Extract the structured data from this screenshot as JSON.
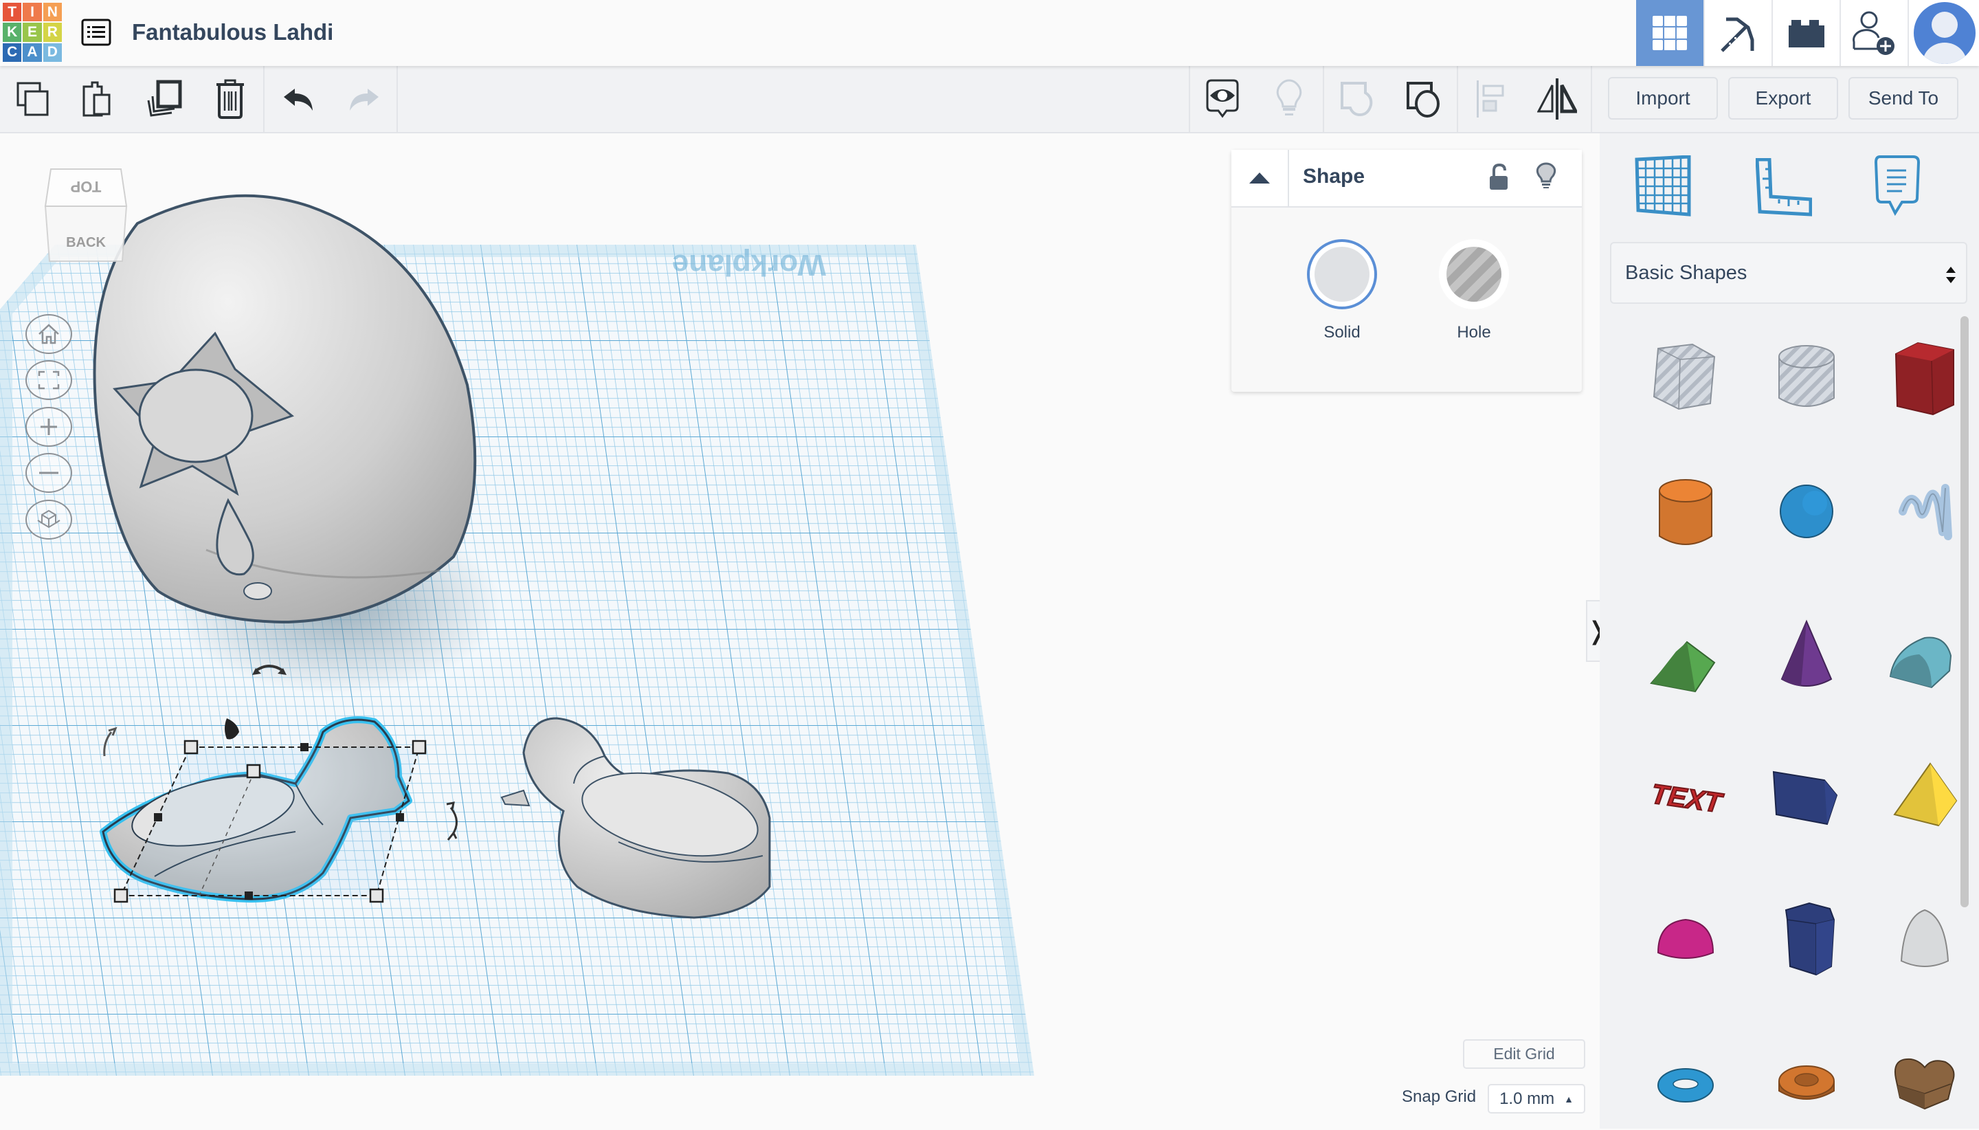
{
  "app": {
    "logo_letters": [
      "T",
      "I",
      "N",
      "K",
      "E",
      "R",
      "C",
      "A",
      "D"
    ],
    "logo_colors": [
      "#e6553a",
      "#ef7a4b",
      "#f59f53",
      "#59b16a",
      "#99c54b",
      "#d4d446",
      "#2c6ab3",
      "#4c8fcb",
      "#7ab9e0"
    ],
    "project_title": "Fantabulous Lahdi"
  },
  "header_nav": [
    {
      "name": "3d-design-view",
      "icon": "grid-icon",
      "active": true
    },
    {
      "name": "blocks-view",
      "icon": "pickaxe-icon",
      "active": false
    },
    {
      "name": "bricks-view",
      "icon": "brick-icon",
      "active": false
    },
    {
      "name": "invite-user",
      "icon": "add-user-icon",
      "active": false
    },
    {
      "name": "user-profile",
      "icon": "avatar-icon",
      "active": false
    }
  ],
  "toolbar": {
    "left_tools": [
      {
        "name": "copy",
        "icon": "copy-icon",
        "enabled": true
      },
      {
        "name": "paste",
        "icon": "paste-icon",
        "enabled": true
      },
      {
        "name": "duplicate",
        "icon": "duplicate-icon",
        "enabled": true
      },
      {
        "name": "delete",
        "icon": "trash-icon",
        "enabled": true
      },
      {
        "name": "undo",
        "icon": "undo-icon",
        "enabled": true
      },
      {
        "name": "redo",
        "icon": "redo-icon",
        "enabled": false
      }
    ],
    "right_tools": [
      {
        "name": "show-all",
        "icon": "eye-icon",
        "enabled": true
      },
      {
        "name": "notes-toggle",
        "icon": "lightbulb-icon",
        "enabled": false
      },
      {
        "name": "group",
        "icon": "group-icon",
        "enabled": false
      },
      {
        "name": "ungroup",
        "icon": "ungroup-icon",
        "enabled": true
      },
      {
        "name": "align",
        "icon": "align-icon",
        "enabled": false
      },
      {
        "name": "mirror",
        "icon": "mirror-icon",
        "enabled": true
      }
    ],
    "import_label": "Import",
    "export_label": "Export",
    "send_to_label": "Send To"
  },
  "viewcube": {
    "top_label": "TOP",
    "back_label": "BACK"
  },
  "nav_controls": [
    {
      "name": "home-view",
      "icon": "home-icon"
    },
    {
      "name": "fit-all",
      "icon": "fit-icon"
    },
    {
      "name": "zoom-in",
      "icon": "plus-icon"
    },
    {
      "name": "zoom-out",
      "icon": "minus-icon"
    },
    {
      "name": "ortho-toggle",
      "icon": "cube-icon"
    }
  ],
  "workplane": {
    "label": "Workplane"
  },
  "shape_panel": {
    "title": "Shape",
    "solid_label": "Solid",
    "hole_label": "Hole",
    "selected": "Solid",
    "accent": "#5b8fd6"
  },
  "right_panel": {
    "tools": [
      {
        "name": "workplane",
        "icon": "workplane-grid-icon"
      },
      {
        "name": "ruler",
        "icon": "ruler-icon"
      },
      {
        "name": "notes",
        "icon": "note-icon"
      }
    ],
    "category": "Basic Shapes",
    "shapes": [
      {
        "name": "box-hole",
        "color": "#c0c6cf"
      },
      {
        "name": "cylinder-hole",
        "color": "#c0c6cf"
      },
      {
        "name": "box",
        "color": "#b72a2f"
      },
      {
        "name": "cylinder",
        "color": "#d2762f"
      },
      {
        "name": "sphere",
        "color": "#2d8fcc"
      },
      {
        "name": "scribble",
        "color": "#a8c4e0"
      },
      {
        "name": "roof",
        "color": "#57a850"
      },
      {
        "name": "cone",
        "color": "#6e3a8f"
      },
      {
        "name": "round-roof",
        "color": "#6bb6c6"
      },
      {
        "name": "text",
        "color": "#c2282b"
      },
      {
        "name": "shape-generator",
        "color": "#2d3e7b"
      },
      {
        "name": "pyramid",
        "color": "#e2c33b"
      },
      {
        "name": "half-sphere",
        "color": "#c82788"
      },
      {
        "name": "polygon",
        "color": "#2d3e7b"
      },
      {
        "name": "paraboloid",
        "color": "#d8dadc"
      },
      {
        "name": "torus",
        "color": "#2d97d1"
      },
      {
        "name": "tube",
        "color": "#d2762f"
      },
      {
        "name": "heart",
        "color": "#8a6440"
      }
    ]
  },
  "grid": {
    "edit_grid_label": "Edit Grid",
    "snap_grid_label": "Snap Grid",
    "snap_value": "1.0 mm"
  }
}
